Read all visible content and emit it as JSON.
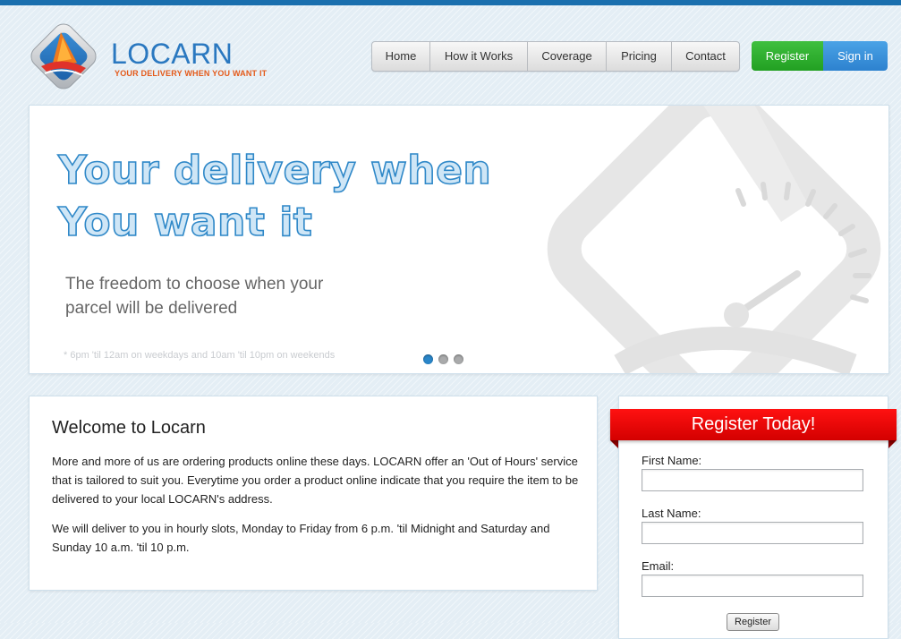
{
  "header": {
    "logo_name": "LOCARN",
    "logo_tagline": "YOUR DELIVERY WHEN YOU WANT IT",
    "nav": [
      {
        "label": "Home"
      },
      {
        "label": "How it Works"
      },
      {
        "label": "Coverage"
      },
      {
        "label": "Pricing"
      },
      {
        "label": "Contact"
      }
    ],
    "register_label": "Register",
    "signin_label": "Sign in"
  },
  "hero": {
    "headline_line1": "Your delivery when",
    "headline_line2": "You want it",
    "subtitle": "The freedom to choose when your parcel will be delivered",
    "note": "* 6pm 'til 12am on weekdays and 10am 'til 10pm on weekends",
    "slides_total": 3,
    "active_slide": 1
  },
  "welcome": {
    "title": "Welcome to Locarn",
    "paragraph1": "More and more of us are ordering products online these days. LOCARN offer an 'Out of Hours' service that is tailored to suit you. Everytime you order a product online indicate that you require the item to be delivered to your local LOCARN's address.",
    "paragraph2": "We will deliver to you in hourly slots, Monday to Friday from 6 p.m. 'til Midnight and Saturday and Sunday 10 a.m. 'til 10 p.m."
  },
  "register_form": {
    "title": "Register Today!",
    "first_name_label": "First Name:",
    "first_name_value": "",
    "last_name_label": "Last Name:",
    "last_name_value": "",
    "email_label": "Email:",
    "email_value": "",
    "submit_label": "Register"
  },
  "colors": {
    "brand_blue": "#2a78c0",
    "brand_orange": "#e45a1a",
    "register_green": "#22a022",
    "signin_blue": "#2d82cf",
    "ribbon_red": "#e00000"
  }
}
